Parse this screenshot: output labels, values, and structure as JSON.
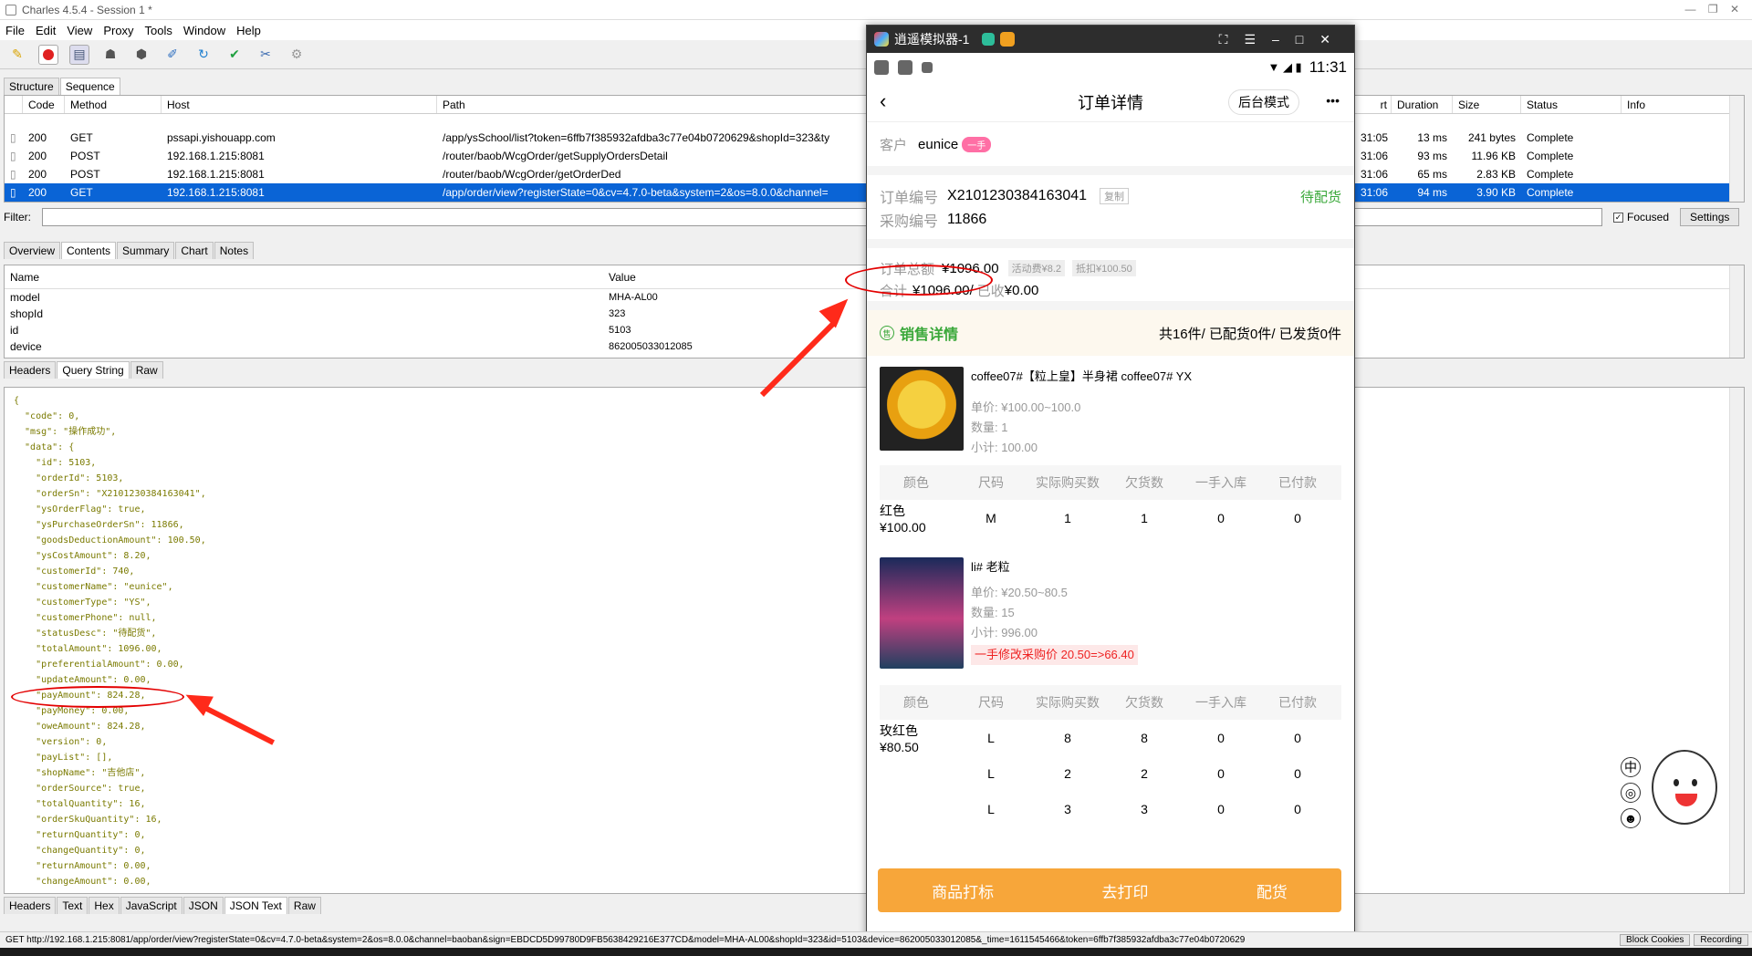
{
  "window": {
    "title": "Charles 4.5.4 - Session 1 *"
  },
  "menu": [
    "File",
    "Edit",
    "View",
    "Proxy",
    "Tools",
    "Window",
    "Help"
  ],
  "view_tabs": [
    "Structure",
    "Sequence"
  ],
  "seq_table": {
    "headers": [
      "Code",
      "Method",
      "Host",
      "Path",
      "rt",
      "Duration",
      "Size",
      "Status",
      "Info"
    ],
    "rows": [
      {
        "code": "200",
        "method": "GET",
        "host": "pssapi.yishouapp.com",
        "path": "/app/ysSchool/list?token=6ffb7f385932afdba3c77e04b0720629&shopId=323&ty",
        "time": "31:05",
        "duration": "13 ms",
        "size": "241 bytes",
        "status": "Complete"
      },
      {
        "code": "200",
        "method": "POST",
        "host": "192.168.1.215:8081",
        "path": "/router/baob/WcgOrder/getSupplyOrdersDetail",
        "time": "31:06",
        "duration": "93 ms",
        "size": "11.96 KB",
        "status": "Complete"
      },
      {
        "code": "200",
        "method": "POST",
        "host": "192.168.1.215:8081",
        "path": "/router/baob/WcgOrder/getOrderDed",
        "time": "31:06",
        "duration": "65 ms",
        "size": "2.83 KB",
        "status": "Complete"
      },
      {
        "code": "200",
        "method": "GET",
        "host": "192.168.1.215:8081",
        "path": "/app/order/view?registerState=0&cv=4.7.0-beta&system=2&os=8.0.0&channel=",
        "time": "31:06",
        "duration": "94 ms",
        "size": "3.90 KB",
        "status": "Complete"
      }
    ]
  },
  "filter": {
    "label": "Filter:",
    "focused_label": "Focused",
    "settings_label": "Settings"
  },
  "detail_tabs": [
    "Overview",
    "Contents",
    "Summary",
    "Chart",
    "Notes"
  ],
  "params": {
    "headers": [
      "Name",
      "Value"
    ],
    "rows": [
      [
        "model",
        "MHA-AL00"
      ],
      [
        "shopId",
        "323"
      ],
      [
        "id",
        "5103"
      ],
      [
        "device",
        "862005033012085"
      ]
    ]
  },
  "req_tabs": [
    "Headers",
    "Query String",
    "Raw"
  ],
  "json_lines": [
    "{",
    "  \"code\": 0,",
    "  \"msg\": \"操作成功\",",
    "  \"data\": {",
    "    \"id\": 5103,",
    "    \"orderId\": 5103,",
    "    \"orderSn\": \"X2101230384163041\",",
    "    \"ysOrderFlag\": true,",
    "    \"ysPurchaseOrderSn\": 11866,",
    "    \"goodsDeductionAmount\": 100.50,",
    "    \"ysCostAmount\": 8.20,",
    "    \"customerId\": 740,",
    "    \"customerName\": \"eunice\",",
    "    \"customerType\": \"YS\",",
    "    \"customerPhone\": null,",
    "    \"statusDesc\": \"待配货\",",
    "    \"totalAmount\": 1096.00,",
    "    \"preferentialAmount\": 0.00,",
    "    \"updateAmount\": 0.00,",
    "    \"payAmount\": 824.28,",
    "    \"payMoney\": 0.00,",
    "    \"oweAmount\": 824.28,",
    "    \"version\": 0,",
    "    \"payList\": [],",
    "    \"shopName\": \"吉他店\",",
    "    \"orderSource\": true,",
    "    \"totalQuantity\": 16,",
    "    \"orderSkuQuantity\": 16,",
    "    \"returnQuantity\": 0,",
    "    \"changeQuantity\": 0,",
    "    \"returnAmount\": 0.00,",
    "    \"changeAmount\": 0.00,"
  ],
  "resp_tabs": [
    "Headers",
    "Text",
    "Hex",
    "JavaScript",
    "JSON",
    "JSON Text",
    "Raw"
  ],
  "statusbar": {
    "url": "GET http://192.168.1.215:8081/app/order/view?registerState=0&cv=4.7.0-beta&system=2&os=8.0.0&channel=baoban&sign=EBDCD5D99780D9FB5638429216E377CD&model=MHA-AL00&shopId=323&id=5103&device=862005033012085&_time=1611545466&token=6ffb7f385932afdba3c77e04b0720629",
    "block": "Block Cookies",
    "recording": "Recording"
  },
  "emulator": {
    "title": "逍遥模拟器-1",
    "time": "11:31",
    "page_title": "订单详情",
    "mode_btn": "后台模式",
    "more": "•••",
    "customer_label": "客户",
    "customer_name": "eunice",
    "customer_tag": "一手",
    "order_no_label": "订单编号",
    "order_no": "X2101230384163041",
    "copy": "复制",
    "status": "待配货",
    "purchase_label": "采购编号",
    "purchase_no": "11866",
    "total_label": "订单总额",
    "total": "¥1096.00",
    "activity_fee": "活动费¥8.2",
    "deduction": "抵扣¥100.50",
    "sum_label": "合计",
    "sum": "¥1096.00/",
    "received_label": "已收",
    "received": "¥0.00",
    "sale_title": "销售详情",
    "sale_icon": "售",
    "sale_summary": "共16件/ 已配货0件/ 已发货0件",
    "table_headers": [
      "颜色",
      "尺码",
      "实际购买数",
      "欠货数",
      "一手入库",
      "已付款"
    ],
    "product1": {
      "name": "coffee07#【粒上皇】半身裙 coffee07# YX",
      "price": "单价: ¥100.00~100.0",
      "qty": "数量: 1",
      "subtotal": "小计: 100.00",
      "rows": [
        [
          "红色 ¥100.00",
          "M",
          "1",
          "1",
          "0",
          "0"
        ]
      ]
    },
    "product2": {
      "name": "li# 老粒",
      "price": "单价: ¥20.50~80.5",
      "qty": "数量: 15",
      "subtotal": "小计: 996.00",
      "note": "一手修改采购价 20.50=>66.40",
      "rows": [
        [
          "玫红色 ¥80.50",
          "L",
          "8",
          "8",
          "0",
          "0"
        ],
        [
          "",
          "L",
          "2",
          "2",
          "0",
          "0"
        ],
        [
          "",
          "L",
          "3",
          "3",
          "0",
          "0"
        ]
      ]
    },
    "btn1": "商品打标",
    "btn2": "去打印",
    "btn3": "配货"
  },
  "side_icons": [
    "中",
    "◎",
    "☻"
  ],
  "colors": {
    "accent": "#f7a63a",
    "selected": "#0a64d6",
    "annotation": "#e30000",
    "status_green": "#3aa83a"
  }
}
